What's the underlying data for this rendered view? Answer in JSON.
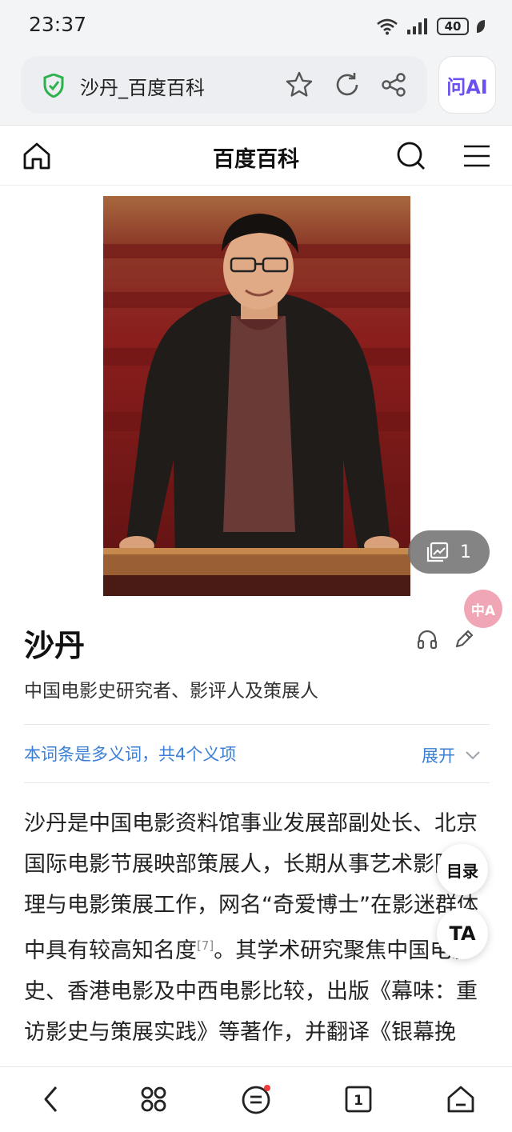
{
  "status_bar": {
    "time": "23:37",
    "battery": "40"
  },
  "browser": {
    "url_title": "沙丹_百度百科",
    "ai_button": "问AI"
  },
  "site": {
    "title": "百度百科"
  },
  "photo": {
    "gallery_count": "1",
    "translate_label": "中A"
  },
  "entry": {
    "title": "沙丹",
    "subtitle": "中国电影史研究者、影评人及策展人",
    "polysemy_text": "本词条是多义词，共4个义项",
    "expand_label": "展开",
    "summary_part1": "沙丹是中国电影资料馆事业发展部副处长、北京国际电影节展映部策展人，长期从事艺术影院管理与电影策展工作，网名“奇爱博士”在影迷群体中具有较高知名度",
    "citation": "[7]",
    "summary_part2": "。其学术研究聚焦中国电影史、香港电影及中西电影比较，出版《幕味：重访影史与策展实践》等著作，并翻译《银幕挽"
  },
  "floating": {
    "toc_label": "目录",
    "ta_label": "TA"
  },
  "bottom_nav": {
    "tab_count": "1"
  },
  "colors": {
    "link_blue": "#3a7fd5",
    "shield_green": "#2bb24c",
    "ai_purple": "#6c4ff0",
    "notify_red": "#ee3b3b"
  }
}
